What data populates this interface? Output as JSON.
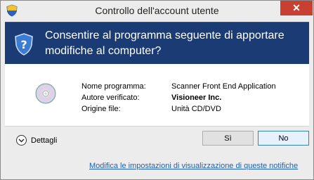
{
  "window": {
    "title": "Controllo dell'account utente",
    "close_label": "✕"
  },
  "banner": {
    "line1": "Consentire al programma seguente di apportare",
    "line2": "modifiche al computer?"
  },
  "details": {
    "program_name_label": "Nome programma:",
    "program_name_value": "Scanner Front End Application",
    "publisher_label": "Autore verificato:",
    "publisher_value": "Visioneer Inc.",
    "origin_label": "Origine file:",
    "origin_value": "Unità CD/DVD"
  },
  "footer": {
    "details_label": "Dettagli",
    "yes_label": "Sì",
    "no_label": "No",
    "settings_link": "Modifica le impostazioni di visualizzazione di queste notifiche"
  },
  "colors": {
    "banner_bg": "#1a3b73",
    "close_bg": "#c84031",
    "link": "#1d5fbf"
  }
}
